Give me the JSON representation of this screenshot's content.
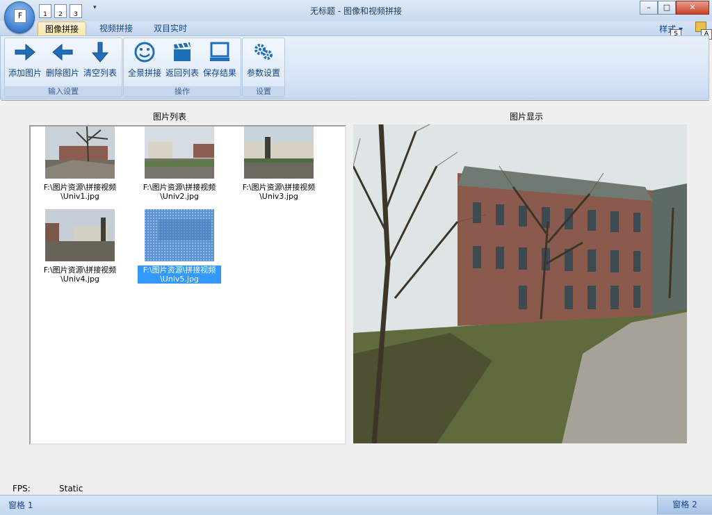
{
  "window": {
    "title": "无标题 - 图像和视频拼接",
    "app_button_letter": "F",
    "quick_access": [
      "1",
      "2",
      "3"
    ],
    "controls": {
      "minimize": "–",
      "maximize": "□",
      "close": "✕"
    }
  },
  "tabs": [
    {
      "label": "图像拼接",
      "active": true
    },
    {
      "label": "视频拼接",
      "active": false
    },
    {
      "label": "双目实时",
      "active": false
    }
  ],
  "style_menu": {
    "label": "样式",
    "keytip": "S",
    "help_keytip": "A"
  },
  "ribbon": {
    "groups": [
      {
        "label": "输入设置",
        "buttons": [
          {
            "label": "添加图片",
            "icon": "arrow-right-icon"
          },
          {
            "label": "删除图片",
            "icon": "arrow-left-icon"
          },
          {
            "label": "清空列表",
            "icon": "arrow-down-icon"
          }
        ]
      },
      {
        "label": "操作",
        "buttons": [
          {
            "label": "全景拼接",
            "icon": "smiley-icon"
          },
          {
            "label": "返回列表",
            "icon": "clapperboard-icon"
          },
          {
            "label": "保存结果",
            "icon": "monitor-icon"
          }
        ]
      },
      {
        "label": "设置",
        "buttons": [
          {
            "label": "参数设置",
            "icon": "gears-icon"
          }
        ]
      }
    ]
  },
  "list_panel": {
    "title": "图片列表",
    "items": [
      {
        "line1": "F:\\图片资源\\拼接视频",
        "line2": "\\Univ1.jpg",
        "selected": false
      },
      {
        "line1": "F:\\图片资源\\拼接视频",
        "line2": "\\Univ2.jpg",
        "selected": false
      },
      {
        "line1": "F:\\图片资源\\拼接视频",
        "line2": "\\Univ3.jpg",
        "selected": false
      },
      {
        "line1": "F:\\图片资源\\拼接视频",
        "line2": "\\Univ4.jpg",
        "selected": false
      },
      {
        "line1": "F:\\图片资源\\拼接视频",
        "line2": "\\Univ5.jpg",
        "selected": true
      }
    ]
  },
  "display_panel": {
    "title": "图片显示"
  },
  "fps": {
    "label": "FPS:",
    "value": "Static"
  },
  "statusbar": {
    "pane1": "窗格 1",
    "pane2": "窗格 2"
  }
}
